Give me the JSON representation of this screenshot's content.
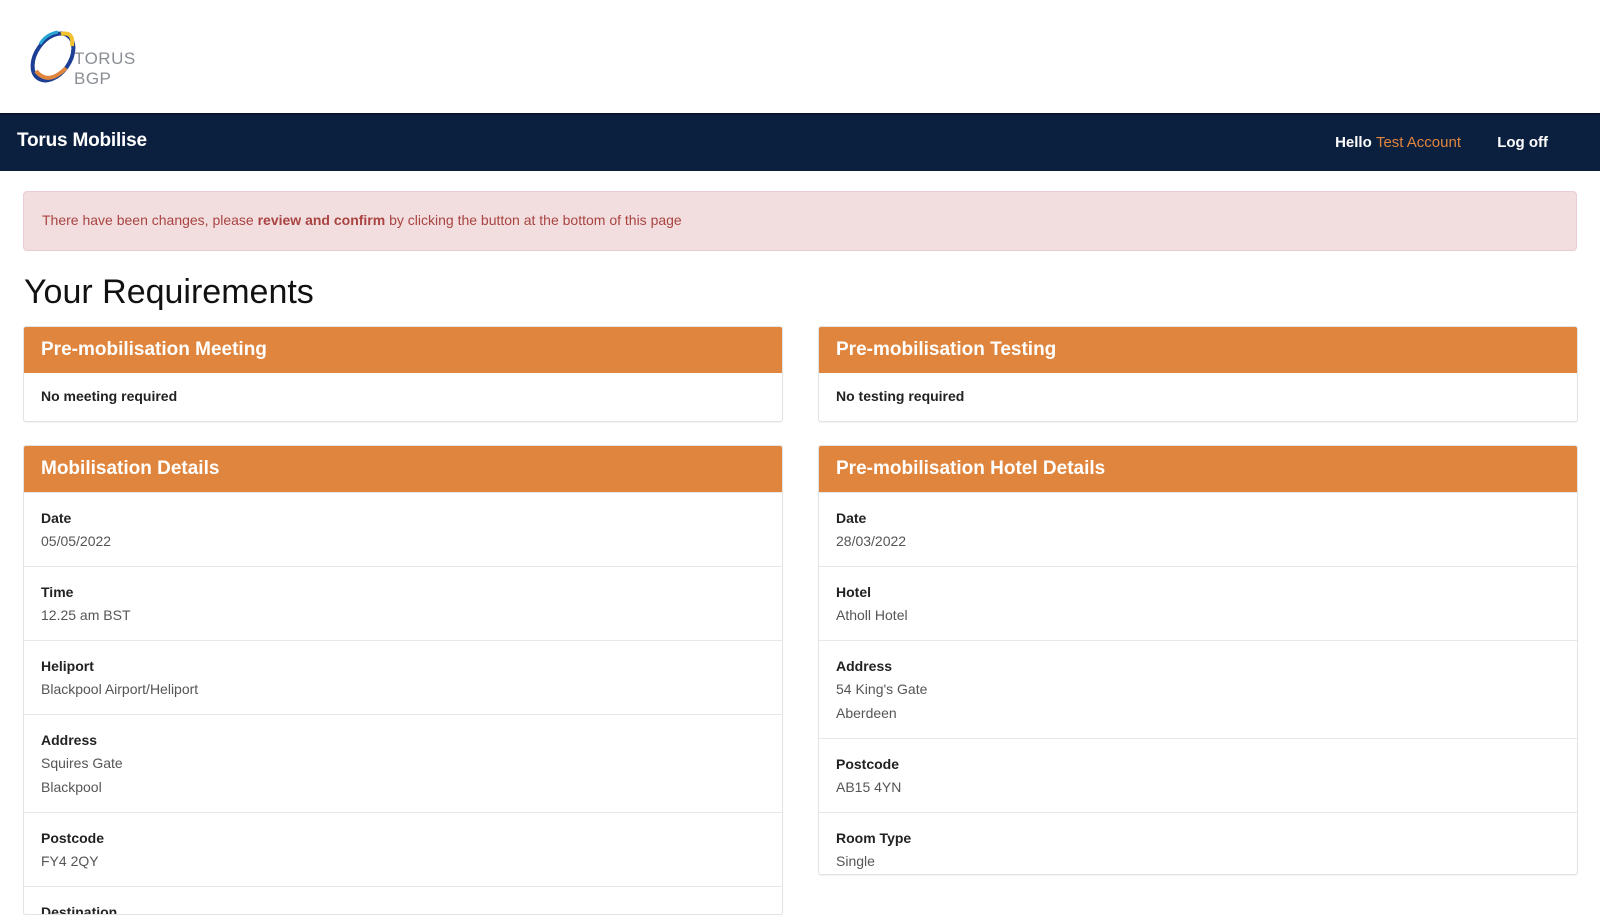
{
  "logo": {
    "text": "TORUS BGP"
  },
  "navbar": {
    "brand": "Torus Mobilise",
    "greeting": "Hello",
    "user_name": "Test Account",
    "logoff_label": "Log off"
  },
  "alert": {
    "text_before": "There have been changes, please",
    "strong": "review and confirm",
    "text_after": "by clicking the button at the bottom of this page"
  },
  "page_title": "Your Requirements",
  "panels": {
    "pre_meeting": {
      "title": "Pre-mobilisation Meeting",
      "body": "No meeting required"
    },
    "pre_testing": {
      "title": "Pre-mobilisation Testing",
      "body": "No testing required"
    },
    "mobilisation": {
      "title": "Mobilisation Details",
      "rows": [
        {
          "label": "Date",
          "value": "05/05/2022"
        },
        {
          "label": "Time",
          "value": "12.25 am BST"
        },
        {
          "label": "Heliport",
          "value": "Blackpool Airport/Heliport"
        },
        {
          "label": "Address",
          "line1": "Squires Gate",
          "line2": "Blackpool"
        },
        {
          "label": "Postcode",
          "value": "FY4 2QY"
        },
        {
          "label": "Destination"
        }
      ]
    },
    "hotel": {
      "title": "Pre-mobilisation Hotel Details",
      "rows": [
        {
          "label": "Date",
          "value": "28/03/2022"
        },
        {
          "label": "Hotel",
          "value": "Atholl Hotel"
        },
        {
          "label": "Address",
          "line1": "54 King's Gate",
          "line2": "Aberdeen"
        },
        {
          "label": "Postcode",
          "value": "AB15 4YN"
        },
        {
          "label": "Room Type",
          "value": "Single"
        }
      ]
    }
  },
  "colors": {
    "navbar": "#0b1f3f",
    "accent": "#e0853d",
    "alert_bg": "#f2dede",
    "alert_text": "#a94442"
  }
}
